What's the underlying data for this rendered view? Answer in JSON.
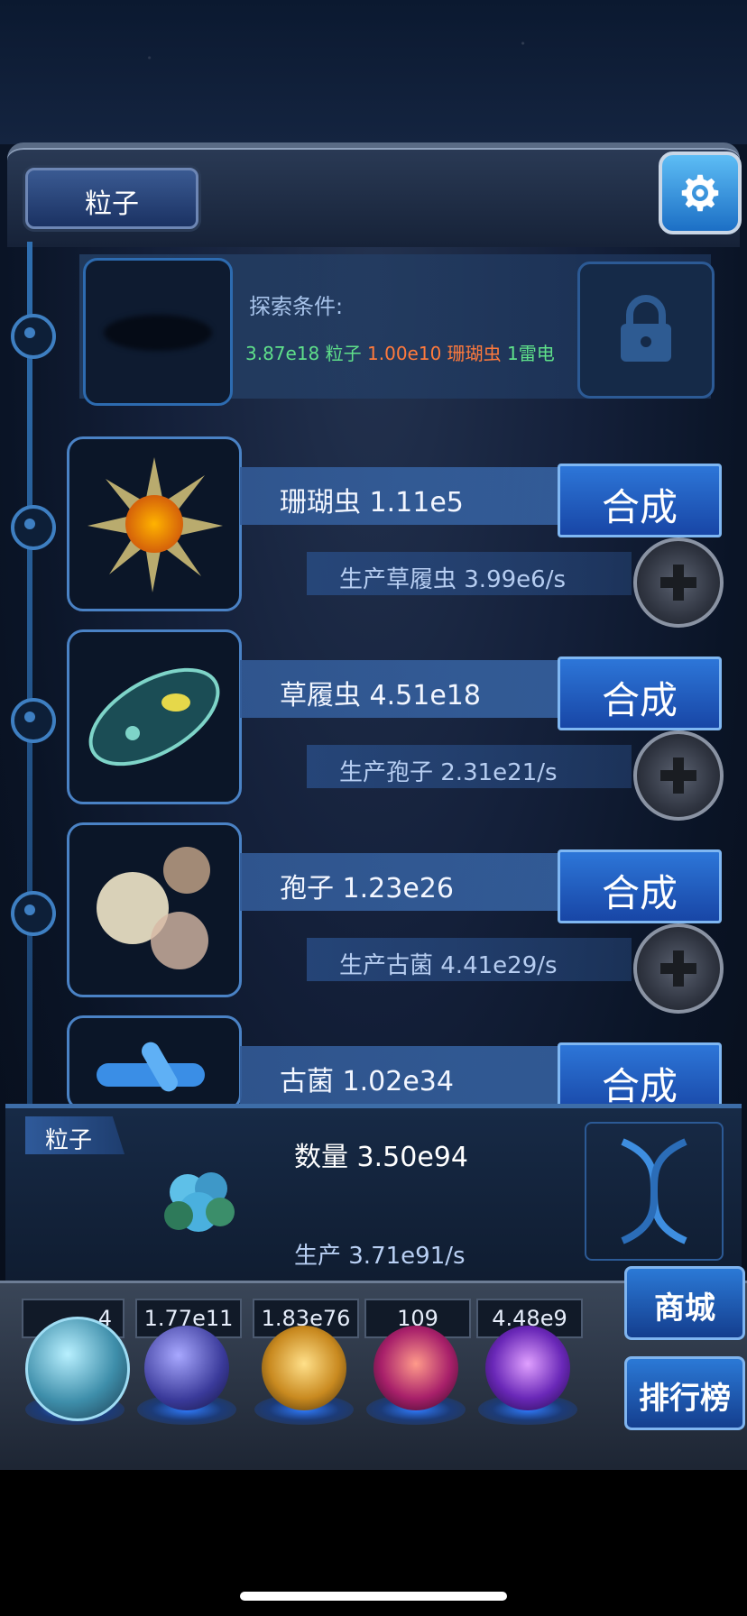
{
  "header": {
    "title": "粒子",
    "settings_icon": "gear-icon"
  },
  "locked": {
    "label": "探索条件:",
    "req1": "3.87e18 粒子",
    "req2": "1.00e10 珊瑚虫",
    "req3": "1雷电",
    "lock_icon": "lock-icon"
  },
  "rows": [
    {
      "name": "珊瑚虫 1.11e5",
      "action": "合成",
      "production": "生产草履虫 3.99e6/s"
    },
    {
      "name": "草履虫 4.51e18",
      "action": "合成",
      "production": "生产孢子 2.31e21/s"
    },
    {
      "name": "孢子 1.23e26",
      "action": "合成",
      "production": "生产古菌 4.41e29/s"
    },
    {
      "name": "古菌 1.02e34",
      "action": "合成"
    }
  ],
  "info": {
    "tag": "粒子",
    "count": "数量 3.50e94",
    "production": "生产 3.71e91/s"
  },
  "resources": [
    "1.77e11",
    "1.83e76",
    "109",
    "4.48e9"
  ],
  "first_resource_partial": "4",
  "side_buttons": {
    "shop": "商城",
    "ranking": "排行榜"
  },
  "colors": {
    "accent": "#2d76d8",
    "green": "#5fe08a",
    "orange": "#ff7a3c"
  }
}
